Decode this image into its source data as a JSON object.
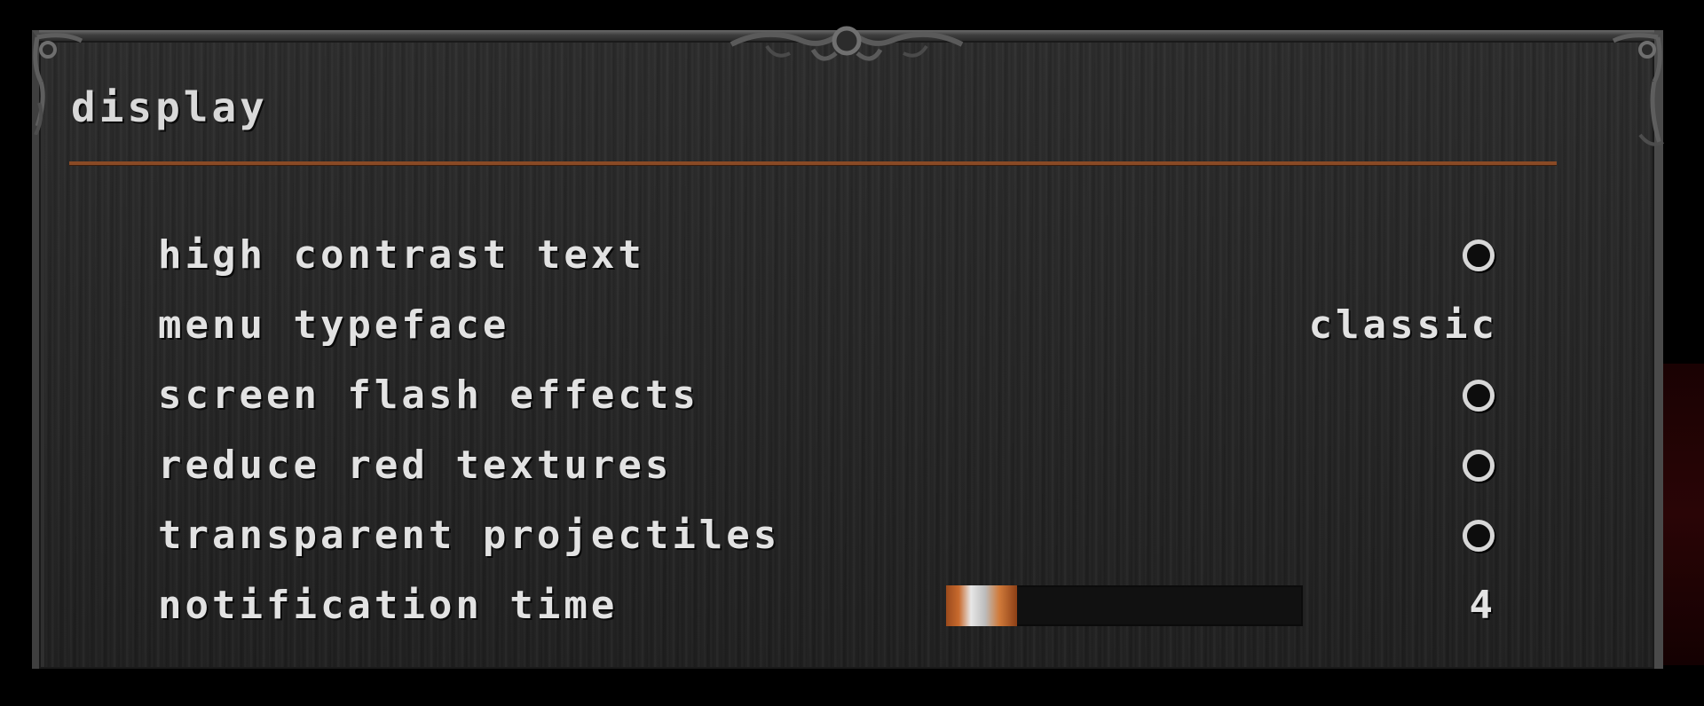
{
  "menu": {
    "section_title": "display",
    "settings": {
      "high_contrast_text": {
        "label": "high contrast text",
        "enabled": false
      },
      "menu_typeface": {
        "label": "menu typeface",
        "value": "classic"
      },
      "screen_flash_effects": {
        "label": "screen flash effects",
        "enabled": false
      },
      "reduce_red_textures": {
        "label": "reduce red textures",
        "enabled": false
      },
      "transparent_projectiles": {
        "label": "transparent projectiles",
        "enabled": false
      },
      "notification_time": {
        "label": "notification time",
        "value": "4",
        "fill_fraction": 0.2
      }
    }
  },
  "colors": {
    "panel_background": "#262626",
    "text": "#e2e2e2",
    "section_rule": "#8a4a25",
    "slider_accent": "#c86a2e",
    "toggle_ring": "#d7d7d7"
  },
  "icons": {
    "frame_ornament": "scrollwork-ornament-icon",
    "toggle_off": "empty-circle-toggle-icon"
  }
}
